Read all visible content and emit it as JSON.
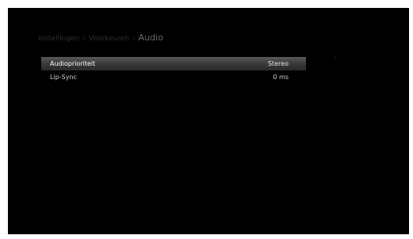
{
  "breadcrumb": {
    "level1": "Instellingen",
    "level2": "Voorkeuren",
    "separator": "›",
    "current": "Audio"
  },
  "menu": {
    "items": [
      {
        "label": "Audioprioriteit",
        "value": "Stereo"
      },
      {
        "label": "Lip-Sync",
        "value": "0 ms"
      }
    ]
  },
  "colors": {
    "background": "#000000",
    "selection": "#4a4a4a",
    "text": "#d8d8d8"
  }
}
